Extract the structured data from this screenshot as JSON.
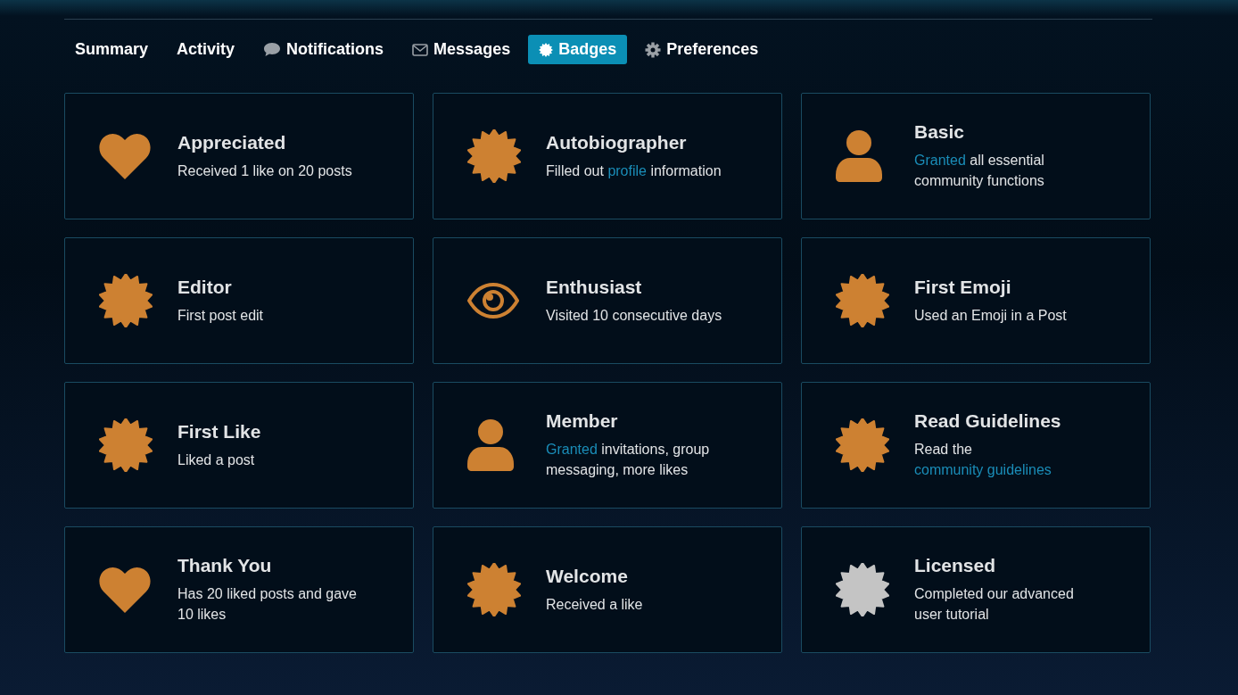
{
  "tabs": [
    {
      "label": "Summary",
      "kind": "plain",
      "selected": false
    },
    {
      "label": "Activity",
      "kind": "plain",
      "selected": false
    },
    {
      "label": "Notifications",
      "kind": "bubble",
      "selected": false
    },
    {
      "label": "Messages",
      "kind": "envelope",
      "selected": false
    },
    {
      "label": "Badges",
      "kind": "burst",
      "selected": true
    },
    {
      "label": "Preferences",
      "kind": "gear",
      "selected": false
    }
  ],
  "badges": [
    {
      "kind": "heart",
      "color": "#cd8132",
      "title": "Appreciated",
      "description": [
        {
          "kind": "text",
          "text": "Received 1 like on 20 posts"
        }
      ]
    },
    {
      "kind": "burst",
      "color": "#cd8132",
      "title": "Autobiographer",
      "description": [
        {
          "kind": "text",
          "text": "Filled out "
        },
        {
          "kind": "link",
          "text": "profile"
        },
        {
          "kind": "text",
          "text": " information"
        }
      ]
    },
    {
      "kind": "person",
      "color": "#cd8132",
      "title": "Basic",
      "description": [
        {
          "kind": "link",
          "text": "Granted"
        },
        {
          "kind": "text",
          "text": " all essential community functions"
        }
      ]
    },
    {
      "kind": "burst",
      "color": "#cd8132",
      "title": "Editor",
      "description": [
        {
          "kind": "text",
          "text": "First post edit"
        }
      ]
    },
    {
      "kind": "eye",
      "color": "#cd8132",
      "title": "Enthusiast",
      "description": [
        {
          "kind": "text",
          "text": "Visited 10 consecutive days"
        }
      ]
    },
    {
      "kind": "burst",
      "color": "#cd8132",
      "title": "First Emoji",
      "description": [
        {
          "kind": "text",
          "text": "Used an Emoji in a Post"
        }
      ]
    },
    {
      "kind": "burst",
      "color": "#cd8132",
      "title": "First Like",
      "description": [
        {
          "kind": "text",
          "text": "Liked a post"
        }
      ]
    },
    {
      "kind": "person",
      "color": "#cd8132",
      "title": "Member",
      "description": [
        {
          "kind": "link",
          "text": "Granted"
        },
        {
          "kind": "text",
          "text": " invitations, group messaging, more likes"
        }
      ]
    },
    {
      "kind": "burst",
      "color": "#cd8132",
      "title": "Read Guidelines",
      "description": [
        {
          "kind": "text",
          "text": "Read the "
        },
        {
          "kind": "link",
          "text": "community guidelines"
        }
      ]
    },
    {
      "kind": "heart",
      "color": "#cd8132",
      "title": "Thank You",
      "description": [
        {
          "kind": "text",
          "text": "Has 20 liked posts and gave 10 likes"
        }
      ]
    },
    {
      "kind": "burst",
      "color": "#cd8132",
      "title": "Welcome",
      "description": [
        {
          "kind": "text",
          "text": "Received a like"
        }
      ]
    },
    {
      "kind": "burst",
      "color": "#c4c4c4",
      "title": "Licensed",
      "description": [
        {
          "kind": "text",
          "text": "Completed our advanced user tutorial"
        }
      ]
    }
  ]
}
